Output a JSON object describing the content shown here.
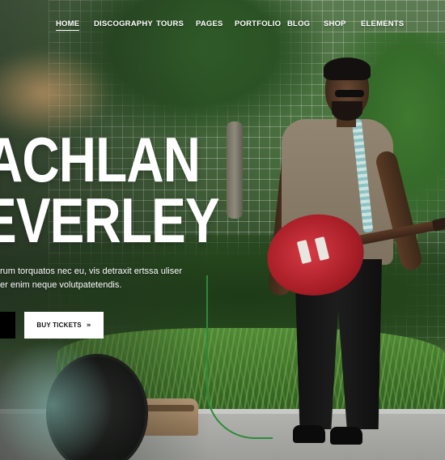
{
  "nav": {
    "items": [
      {
        "label": "HOME",
        "active": true
      },
      {
        "label": "DISCOGRAPHY",
        "active": false
      },
      {
        "label": "TOURS",
        "active": false
      },
      {
        "label": "PAGES",
        "active": false
      },
      {
        "label": "PORTFOLIO",
        "active": false
      },
      {
        "label": "BLOG",
        "active": false
      },
      {
        "label": "SHOP",
        "active": false
      },
      {
        "label": "ELEMENTS",
        "active": false
      }
    ]
  },
  "hero": {
    "line1": "ACHLAN",
    "line2": "EVERLEY",
    "subtitle_line1": "rum torquatos nec eu, vis detraxit ertssa uliser",
    "subtitle_line2": "er enim neque volutpatetendis."
  },
  "buttons": {
    "tickets_label": "BUY TICKETS",
    "tickets_icon": "double-chevron-right-icon"
  },
  "colors": {
    "nav_text": "#ffffff",
    "hero_text": "#ffffff",
    "button_light_bg": "#ffffff",
    "button_dark_bg": "#000000"
  }
}
